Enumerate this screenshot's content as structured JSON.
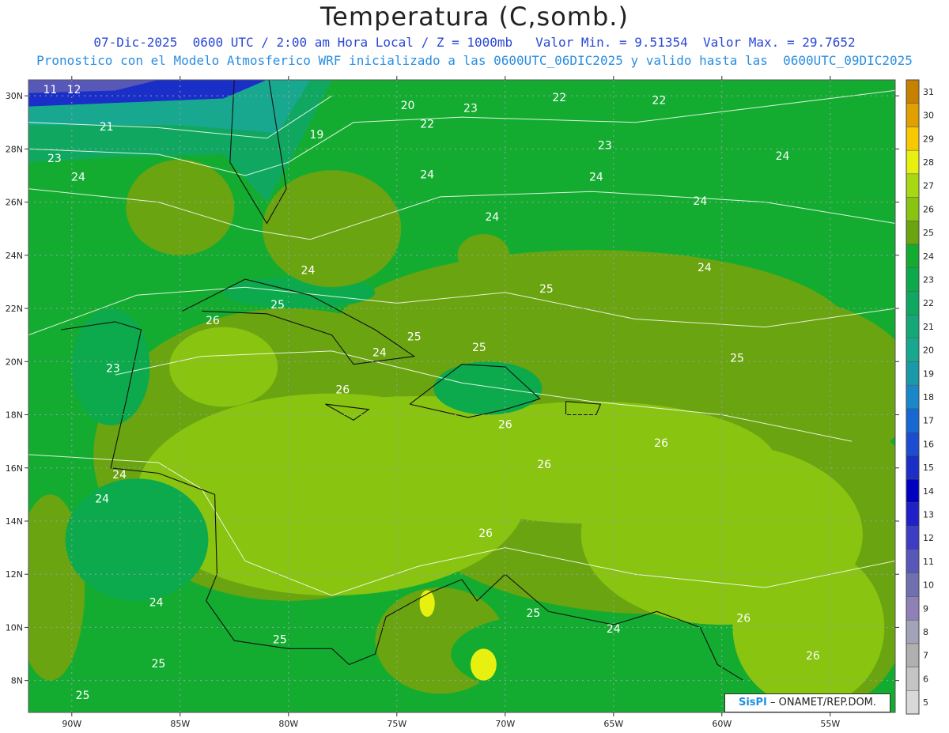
{
  "title": "Temperatura (C,somb.)",
  "subtitle_line1": "07-Dic-2025  0600 UTC / 2:00 am Hora Local / Z = 1000mb   Valor Min. = 9.51354  Valor Max. = 29.7652",
  "subtitle_line2": "Pronostico con el Modelo Atmosferico WRF inicializado a las 0600UTC_06DIC2025 y valido hasta las  0600UTC_09DIC2025",
  "credit": {
    "brand": "SisPI",
    "text": "– ONAMET/REP.DOM."
  },
  "map": {
    "lon_range": [
      -92,
      -52
    ],
    "lat_range": [
      6.8,
      30.6
    ],
    "lon_ticks": [
      {
        "value": -90,
        "label": "90W"
      },
      {
        "value": -85,
        "label": "85W"
      },
      {
        "value": -80,
        "label": "80W"
      },
      {
        "value": -75,
        "label": "75W"
      },
      {
        "value": -70,
        "label": "70W"
      },
      {
        "value": -65,
        "label": "65W"
      },
      {
        "value": -60,
        "label": "60W"
      },
      {
        "value": -55,
        "label": "55W"
      }
    ],
    "lat_ticks": [
      {
        "value": 8,
        "label": "8N"
      },
      {
        "value": 10,
        "label": "10N"
      },
      {
        "value": 12,
        "label": "12N"
      },
      {
        "value": 14,
        "label": "14N"
      },
      {
        "value": 16,
        "label": "16N"
      },
      {
        "value": 18,
        "label": "18N"
      },
      {
        "value": 20,
        "label": "20N"
      },
      {
        "value": 22,
        "label": "22N"
      },
      {
        "value": 24,
        "label": "24N"
      },
      {
        "value": 26,
        "label": "26N"
      },
      {
        "value": 28,
        "label": "28N"
      },
      {
        "value": 30,
        "label": "30N"
      }
    ],
    "grid": true,
    "contour_labels": [
      {
        "lon": -91.0,
        "lat": 30.1,
        "text": "11"
      },
      {
        "lon": -89.9,
        "lat": 30.1,
        "text": "12"
      },
      {
        "lon": -90.8,
        "lat": 27.5,
        "text": "23"
      },
      {
        "lon": -89.7,
        "lat": 26.8,
        "text": "24"
      },
      {
        "lon": -88.4,
        "lat": 28.7,
        "text": "21"
      },
      {
        "lon": -78.7,
        "lat": 28.4,
        "text": "19"
      },
      {
        "lon": -74.5,
        "lat": 29.5,
        "text": "20"
      },
      {
        "lon": -73.6,
        "lat": 28.8,
        "text": "22"
      },
      {
        "lon": -71.6,
        "lat": 29.4,
        "text": "23"
      },
      {
        "lon": -73.6,
        "lat": 26.9,
        "text": "24"
      },
      {
        "lon": -67.5,
        "lat": 29.8,
        "text": "22"
      },
      {
        "lon": -62.9,
        "lat": 29.7,
        "text": "22"
      },
      {
        "lon": -65.4,
        "lat": 28.0,
        "text": "23"
      },
      {
        "lon": -65.8,
        "lat": 26.8,
        "text": "24"
      },
      {
        "lon": -57.2,
        "lat": 27.6,
        "text": "24"
      },
      {
        "lon": -61.0,
        "lat": 25.9,
        "text": "24"
      },
      {
        "lon": -70.6,
        "lat": 25.3,
        "text": "24"
      },
      {
        "lon": -60.8,
        "lat": 23.4,
        "text": "24"
      },
      {
        "lon": -79.1,
        "lat": 23.3,
        "text": "24"
      },
      {
        "lon": -68.1,
        "lat": 22.6,
        "text": "25"
      },
      {
        "lon": -80.5,
        "lat": 22.0,
        "text": "25"
      },
      {
        "lon": -83.5,
        "lat": 21.4,
        "text": "26"
      },
      {
        "lon": -74.2,
        "lat": 20.8,
        "text": "25"
      },
      {
        "lon": -75.8,
        "lat": 20.2,
        "text": "24"
      },
      {
        "lon": -71.2,
        "lat": 20.4,
        "text": "25"
      },
      {
        "lon": -59.3,
        "lat": 20.0,
        "text": "25"
      },
      {
        "lon": -88.1,
        "lat": 19.6,
        "text": "23"
      },
      {
        "lon": -77.5,
        "lat": 18.8,
        "text": "26"
      },
      {
        "lon": -70.0,
        "lat": 17.5,
        "text": "26"
      },
      {
        "lon": -62.8,
        "lat": 16.8,
        "text": "26"
      },
      {
        "lon": -68.2,
        "lat": 16.0,
        "text": "26"
      },
      {
        "lon": -87.8,
        "lat": 15.6,
        "text": "24"
      },
      {
        "lon": -88.6,
        "lat": 14.7,
        "text": "24"
      },
      {
        "lon": -70.9,
        "lat": 13.4,
        "text": "26"
      },
      {
        "lon": -86.1,
        "lat": 10.8,
        "text": "24"
      },
      {
        "lon": -68.7,
        "lat": 10.4,
        "text": "25"
      },
      {
        "lon": -65.0,
        "lat": 9.8,
        "text": "24"
      },
      {
        "lon": -59.0,
        "lat": 10.2,
        "text": "26"
      },
      {
        "lon": -80.4,
        "lat": 9.4,
        "text": "25"
      },
      {
        "lon": -86.0,
        "lat": 8.5,
        "text": "25"
      },
      {
        "lon": -55.8,
        "lat": 8.8,
        "text": "26"
      },
      {
        "lon": -89.5,
        "lat": 7.3,
        "text": "25"
      }
    ]
  },
  "colorbar": {
    "levels": [
      5,
      6,
      7,
      8,
      9,
      10,
      11,
      12,
      13,
      14,
      15,
      16,
      17,
      18,
      19,
      20,
      21,
      22,
      23,
      24,
      25,
      26,
      27,
      28,
      29,
      30,
      31
    ],
    "colors": [
      "#d8d8d8",
      "#c4c4c4",
      "#b0b0b0",
      "#a2a2b8",
      "#9080b8",
      "#7070b0",
      "#5858b8",
      "#3c3cc4",
      "#2020c8",
      "#0000c0",
      "#1a2ec8",
      "#1c4cd0",
      "#1868d4",
      "#1a88c8",
      "#1a9aa8",
      "#18a890",
      "#14a878",
      "#10a860",
      "#0caa4c",
      "#14ac30",
      "#6aa410",
      "#88c410",
      "#a8d814",
      "#e8f010",
      "#f8c800",
      "#e0a000",
      "#c88000"
    ]
  },
  "field": {
    "min": 9.51354,
    "max": 29.7652,
    "units": "C"
  }
}
